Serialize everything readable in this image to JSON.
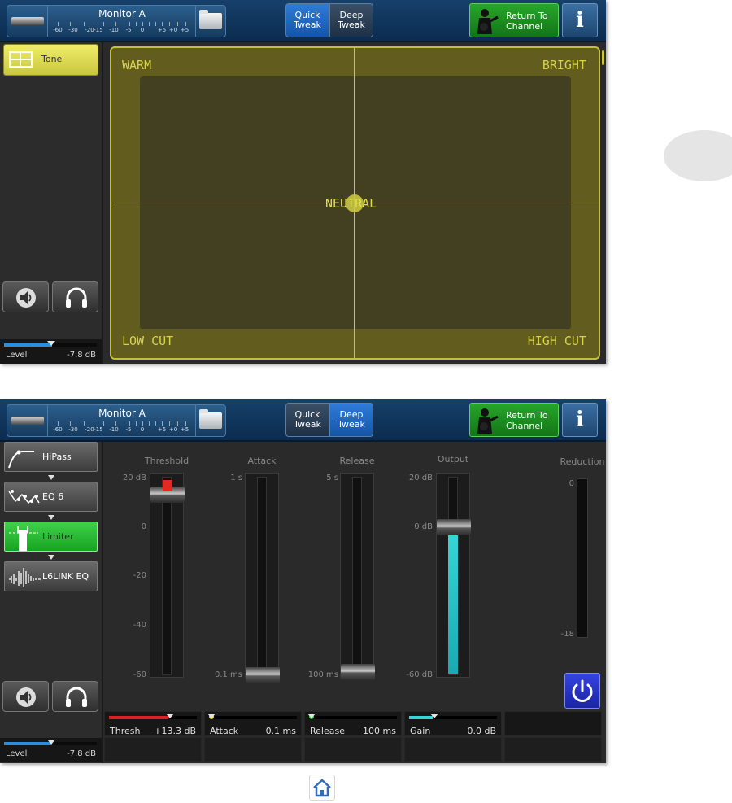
{
  "header": {
    "monitor_name": "Monitor A",
    "meter_ticks": [
      "-60",
      "-30",
      "-20",
      "-15",
      "-10",
      "-5",
      "0",
      "+5",
      "+0",
      "+5"
    ],
    "quick_tweak_line1": "Quick",
    "quick_tweak_line2": "Tweak",
    "deep_tweak_line1": "Deep",
    "deep_tweak_line2": "Tweak",
    "return_line1": "Return To",
    "return_line2": "Channel",
    "info_label": "i"
  },
  "panel1": {
    "active_tab": "Quick Tweak",
    "sidebar_item": "Tone",
    "level_label": "Level",
    "level_value": "-7.8 dB",
    "level_fraction": 0.52,
    "tone_pad": {
      "top_left": "WARM",
      "top_right": "BRIGHT",
      "bottom_left": "LOW CUT",
      "bottom_right": "HIGH CUT",
      "center": "NEUTRAL"
    }
  },
  "panel2": {
    "active_tab": "Deep Tweak",
    "chain": [
      "HiPass",
      "EQ 6",
      "Limiter",
      "L6LINK EQ"
    ],
    "active_chain_item": "Limiter",
    "level_label": "Level",
    "level_value": "-7.8 dB",
    "sliders": {
      "threshold": {
        "title": "Threshold",
        "labels": [
          "20 dB",
          "0",
          "-20",
          "-40",
          "-60"
        ]
      },
      "attack": {
        "title": "Attack",
        "top": "1 s",
        "bottom": "0.1 ms"
      },
      "release": {
        "title": "Release",
        "top": "5 s",
        "bottom": "100 ms"
      },
      "output": {
        "title": "Output",
        "top": "20 dB",
        "mid": "0 dB",
        "bottom": "-60 dB"
      },
      "reduction": {
        "title": "Reduction",
        "top": "0",
        "bottom": "-18"
      }
    },
    "params": [
      {
        "name": "Thresh",
        "value": "+13.3 dB",
        "fraction": 0.68,
        "color": "#e02020"
      },
      {
        "name": "Attack",
        "value": "0.1 ms",
        "fraction": 0.0,
        "color": "#e8e020"
      },
      {
        "name": "Release",
        "value": "100 ms",
        "fraction": 0.0,
        "color": "#20d020"
      },
      {
        "name": "Gain",
        "value": "0.0 dB",
        "fraction": 0.27,
        "color": "#30d8d8"
      }
    ]
  },
  "icons": [
    "device-icon",
    "folder-icon",
    "guitarist-icon",
    "info-icon",
    "speaker-icon",
    "headphones-icon",
    "power-icon",
    "home-icon"
  ],
  "colors": {
    "header_blue": "#0b2c4f",
    "tone_yellow": "#c9c63f",
    "active_green": "#18a322",
    "tweak_active": "#1356a9",
    "bypass_blue": "#1a24a6"
  }
}
